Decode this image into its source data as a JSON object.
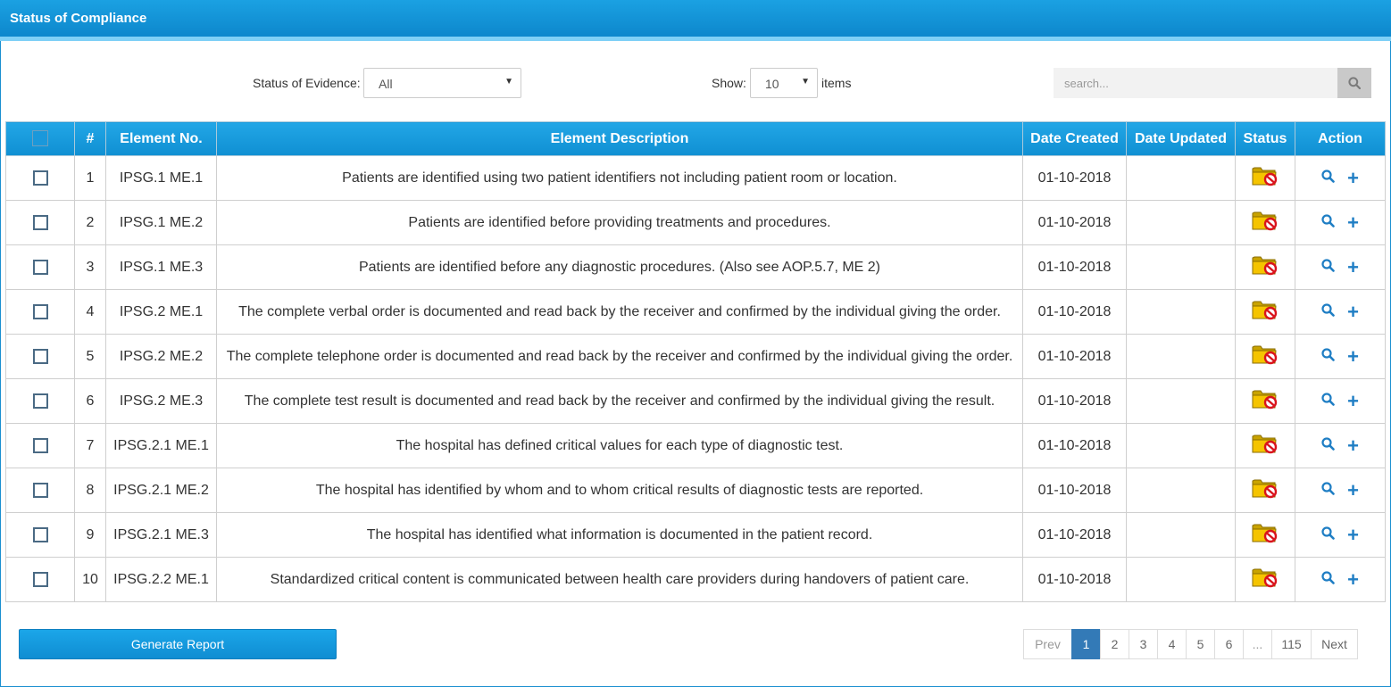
{
  "header": {
    "title": "Status of Compliance"
  },
  "filters": {
    "status_label": "Status of Evidence:",
    "status_value": "All",
    "show_label": "Show:",
    "show_value": "10",
    "items_label": "items",
    "search_placeholder": "search..."
  },
  "table": {
    "columns": [
      "#",
      "Element No.",
      "Element Description",
      "Date Created",
      "Date Updated",
      "Status",
      "Action"
    ],
    "rows": [
      {
        "num": "1",
        "element": "IPSG.1 ME.1",
        "description": "Patients are identified using two patient identifiers not including patient room or location.",
        "created": "01-10-2018",
        "updated": ""
      },
      {
        "num": "2",
        "element": "IPSG.1 ME.2",
        "description": "Patients are identified before providing treatments and procedures.",
        "created": "01-10-2018",
        "updated": ""
      },
      {
        "num": "3",
        "element": "IPSG.1 ME.3",
        "description": "Patients are identified before any diagnostic procedures. (Also see AOP.5.7, ME 2)",
        "created": "01-10-2018",
        "updated": ""
      },
      {
        "num": "4",
        "element": "IPSG.2 ME.1",
        "description": "The complete verbal order is documented and read back by the receiver and confirmed by the individual giving the order.",
        "created": "01-10-2018",
        "updated": ""
      },
      {
        "num": "5",
        "element": "IPSG.2 ME.2",
        "description": "The complete telephone order is documented and read back by the receiver and confirmed by the individual giving the order.",
        "created": "01-10-2018",
        "updated": ""
      },
      {
        "num": "6",
        "element": "IPSG.2 ME.3",
        "description": "The complete test result is documented and read back by the receiver and confirmed by the individual giving the result.",
        "created": "01-10-2018",
        "updated": ""
      },
      {
        "num": "7",
        "element": "IPSG.2.1 ME.1",
        "description": "The hospital has defined critical values for each type of diagnostic test.",
        "created": "01-10-2018",
        "updated": ""
      },
      {
        "num": "8",
        "element": "IPSG.2.1 ME.2",
        "description": "The hospital has identified by whom and to whom critical results of diagnostic tests are reported.",
        "created": "01-10-2018",
        "updated": ""
      },
      {
        "num": "9",
        "element": "IPSG.2.1 ME.3",
        "description": "The hospital has identified what information is documented in the patient record.",
        "created": "01-10-2018",
        "updated": ""
      },
      {
        "num": "10",
        "element": "IPSG.2.2 ME.1",
        "description": "Standardized critical content is communicated between health care providers during handovers of patient care.",
        "created": "01-10-2018",
        "updated": ""
      }
    ],
    "status_icon": "folder-blocked-icon",
    "action_icons": [
      "search-icon",
      "plus-icon"
    ]
  },
  "footer": {
    "generate_label": "Generate Report",
    "pagination": [
      "Prev",
      "1",
      "2",
      "3",
      "4",
      "5",
      "6",
      "...",
      "115",
      "Next"
    ],
    "active_page": "1"
  },
  "colors": {
    "header_blue": "#0d87cc",
    "accent_light": "#7fd0f6",
    "active_page": "#337ab7",
    "status_folder": "#f5c400",
    "status_block": "#d9141c"
  }
}
